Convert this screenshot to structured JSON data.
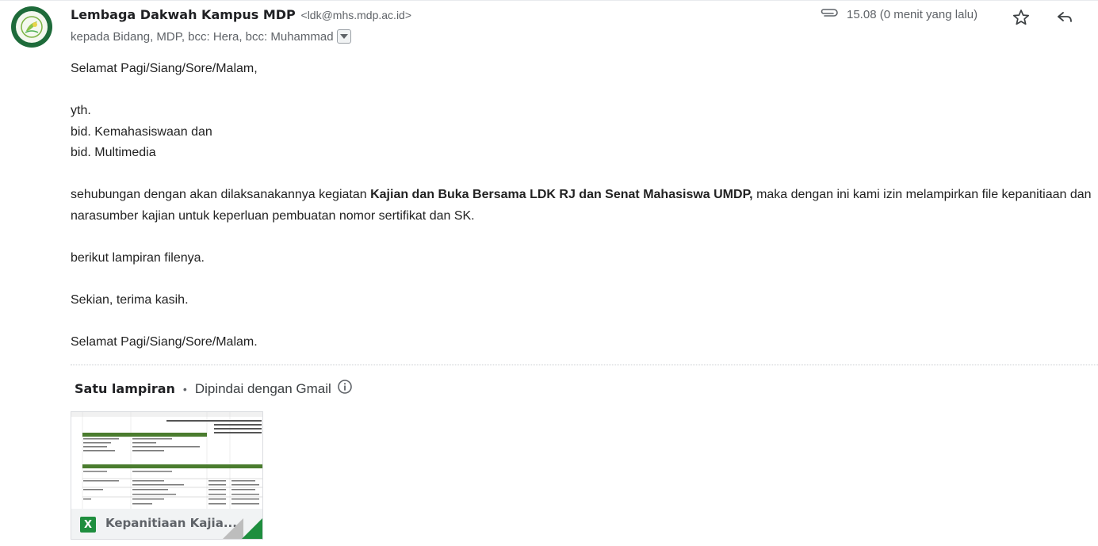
{
  "sender": {
    "name": "Lembaga Dakwah Kampus MDP",
    "email": "<ldk@mhs.mdp.ac.id>"
  },
  "recipients": "kepada Bidang, MDP, bcc: Hera, bcc: Muhammad",
  "timestamp": "15.08 (0 menit yang lalu)",
  "icons": {
    "attachment": "paperclip-icon",
    "star": "star-icon",
    "reply": "reply-icon",
    "dropdown": "chevron-down-icon",
    "info": "info-icon",
    "file_type": "excel-icon"
  },
  "body": {
    "greeting": "Selamat Pagi/Siang/Sore/Malam,",
    "yth": "yth.",
    "bid1": "bid. Kemahasiswaan dan",
    "bid2": "bid. Multimedia",
    "para_pre": "sehubungan dengan akan dilaksanakannya kegiatan ",
    "para_bold": "Kajian dan Buka Bersama LDK RJ dan Senat Mahasiswa UMDP,",
    "para_post": " maka dengan ini kami izin melampirkan file kepanitiaan dan narasumber kajian untuk keperluan pembuatan nomor sertifikat dan SK.",
    "lampiran": "berikut lampiran filenya.",
    "closing": "Sekian, terima kasih.",
    "signoff": "Selamat Pagi/Siang/Sore/Malam."
  },
  "attachments": {
    "heading": "Satu lampiran",
    "separator": "•",
    "scanned": "Dipindai dengan Gmail",
    "file": {
      "name": "Kepanitiaan Kajia...",
      "badge": "X",
      "accent": "#1e8e3e"
    }
  },
  "colors": {
    "text": "#202124",
    "muted": "#5f6368",
    "avatar": "#1e6b3a",
    "excel_green": "#1e8e3e"
  }
}
